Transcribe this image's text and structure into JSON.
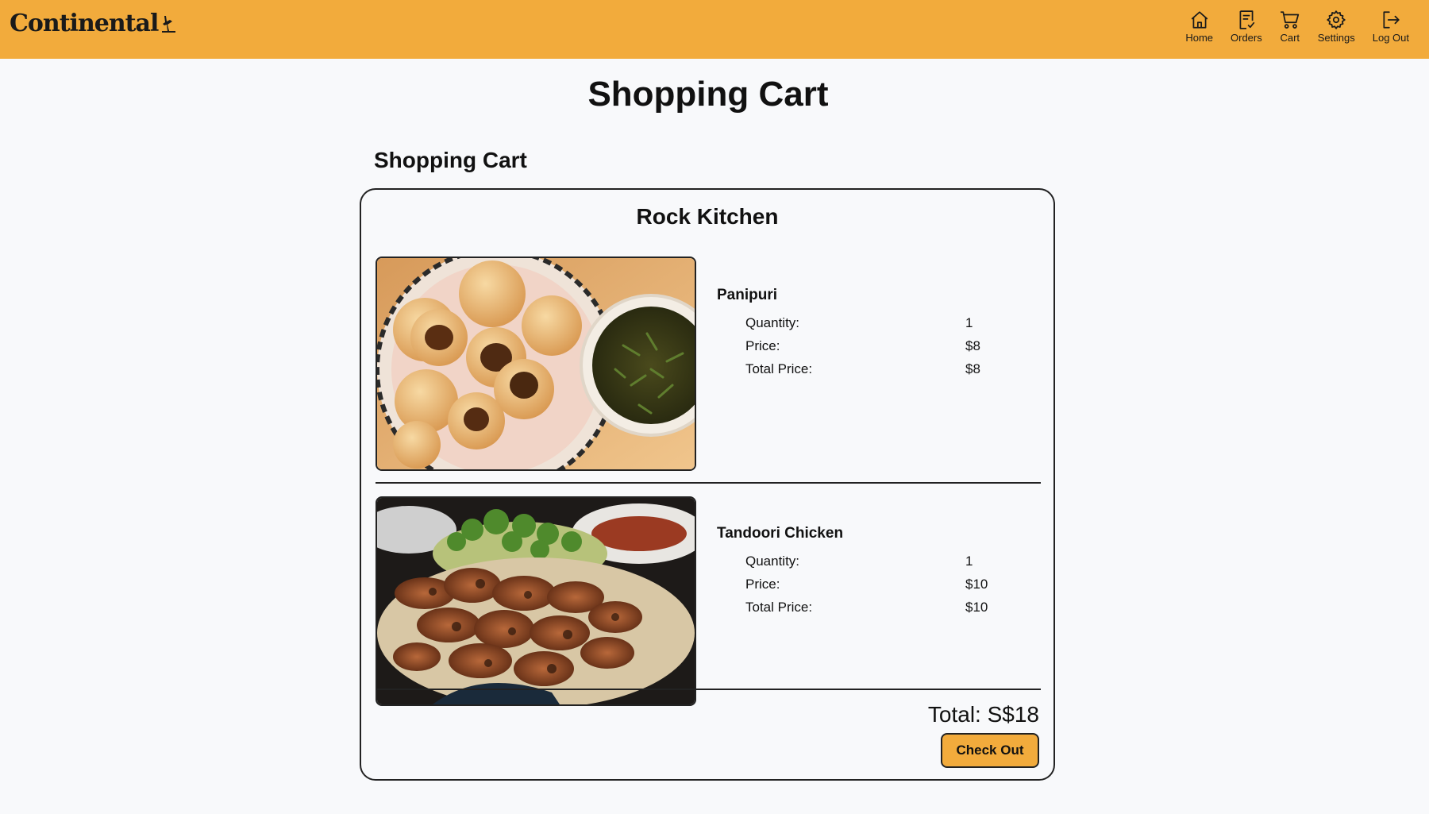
{
  "header": {
    "logo_text": "Continental",
    "brand_color": "#f2ab3c",
    "nav": [
      {
        "label": "Home",
        "icon": "home-icon"
      },
      {
        "label": "Orders",
        "icon": "orders-icon"
      },
      {
        "label": "Cart",
        "icon": "cart-icon"
      },
      {
        "label": "Settings",
        "icon": "gear-icon"
      },
      {
        "label": "Log Out",
        "icon": "logout-icon"
      }
    ]
  },
  "page_title": "Shopping Cart",
  "section_title": "Shopping Cart",
  "cart": {
    "restaurant": "Rock Kitchen",
    "items": [
      {
        "name": "Panipuri",
        "quantity_label": "Quantity:",
        "quantity": "1",
        "price_label": "Price:",
        "price": "$8",
        "total_label": "Total Price:",
        "total": "$8"
      },
      {
        "name": "Tandoori Chicken",
        "quantity_label": "Quantity:",
        "quantity": "1",
        "price_label": "Price:",
        "price": "$10",
        "total_label": "Total Price:",
        "total": "$10"
      }
    ],
    "grand_total": "Total: S$18",
    "checkout_label": "Check Out"
  }
}
